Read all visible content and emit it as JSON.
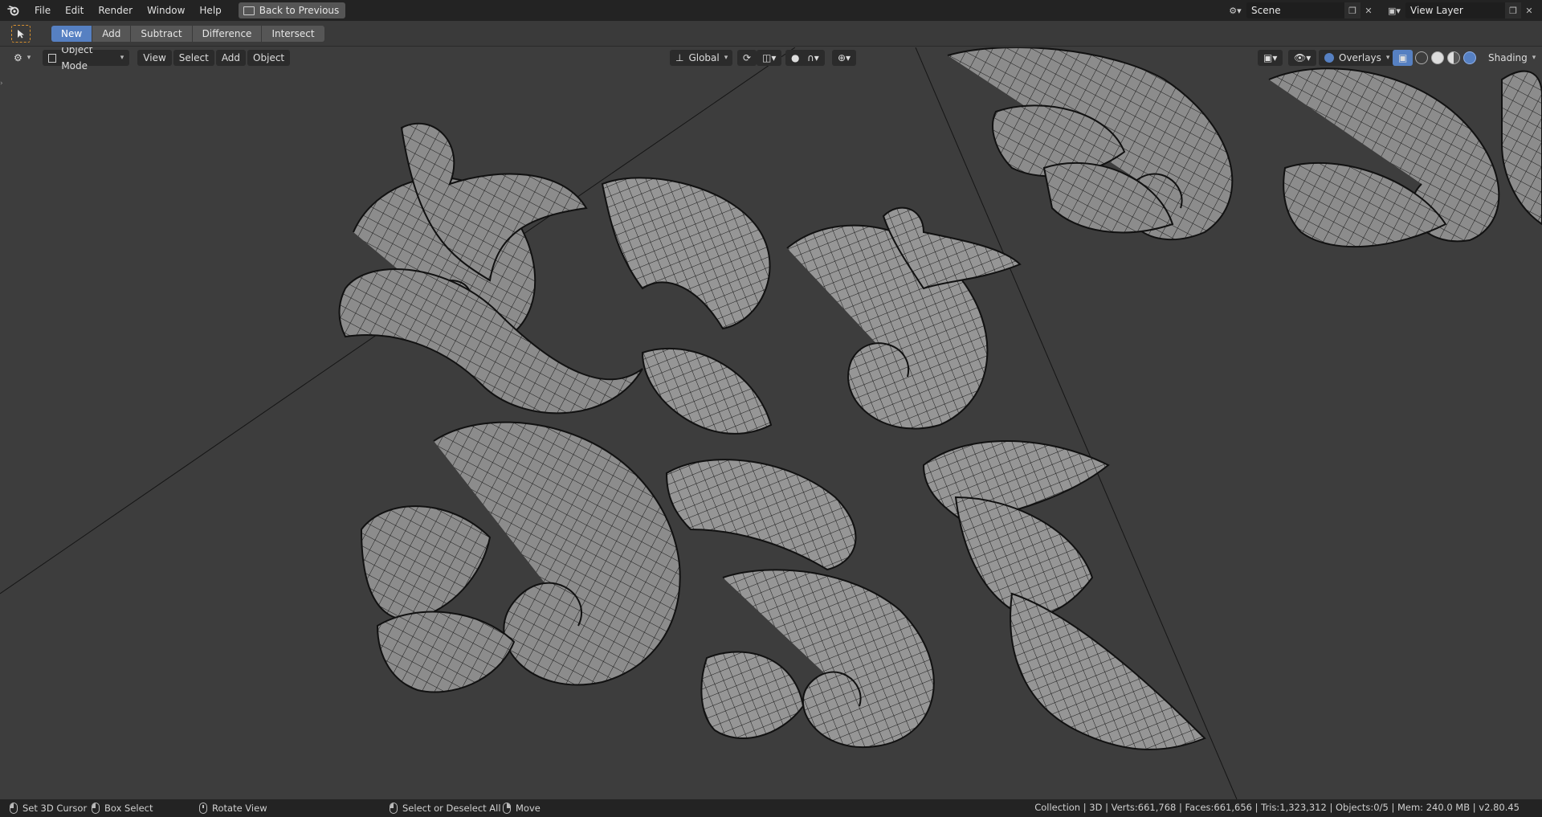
{
  "topbar": {
    "menu": [
      "File",
      "Edit",
      "Render",
      "Window",
      "Help"
    ],
    "back_button": "Back to Previous",
    "scene": "Scene",
    "view_layer": "View Layer"
  },
  "tool_header": {
    "modes": [
      "New",
      "Add",
      "Subtract",
      "Difference",
      "Intersect"
    ],
    "active_mode": "New"
  },
  "viewport_header": {
    "mode": "Object Mode",
    "menus": [
      "View",
      "Select",
      "Add",
      "Object"
    ],
    "orientation": "Global",
    "overlays": "Overlays",
    "shading": "Shading"
  },
  "statusbar": {
    "hints": [
      {
        "label": "Set 3D Cursor",
        "icon": "mouse-left-icon"
      },
      {
        "label": "Box Select",
        "icon": "mouse-left-drag-icon"
      },
      {
        "label": "Rotate View",
        "icon": "mouse-middle-icon"
      },
      {
        "label": "Select or Deselect All",
        "icon": "mouse-left-icon"
      },
      {
        "label": "Move",
        "icon": "mouse-right-icon"
      }
    ],
    "stats": "Collection | 3D | Verts:661,768 | Faces:661,656 | Tris:1,323,312 | Objects:0/5 | Mem: 240.0 MB | v2.80.45"
  },
  "colors": {
    "accent": "#5680c2",
    "viewport_bg": "#3d3d3d",
    "header_bg": "#232323",
    "active_tool": "#d6902f"
  }
}
